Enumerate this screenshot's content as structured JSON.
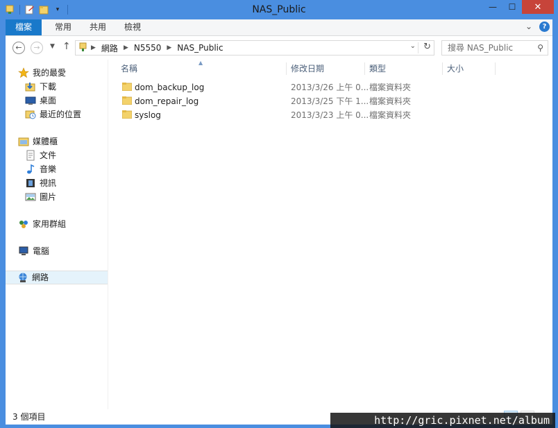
{
  "window": {
    "title": "NAS_Public",
    "buttons": {
      "minimize": "—",
      "maximize": "☐",
      "close": "✕"
    }
  },
  "ribbon": {
    "tabs": [
      "檔案",
      "常用",
      "共用",
      "檢視"
    ]
  },
  "address": {
    "crumbs": [
      "網路",
      "N5550",
      "NAS_Public"
    ],
    "search_placeholder": "搜尋 NAS_Public"
  },
  "nav": {
    "favorites": {
      "label": "我的最愛",
      "items": [
        "下載",
        "桌面",
        "最近的位置"
      ]
    },
    "libraries": {
      "label": "媒體櫃",
      "items": [
        "文件",
        "音樂",
        "視訊",
        "圖片"
      ]
    },
    "homegroup": "家用群組",
    "computer": "電腦",
    "network": "網路"
  },
  "columns": {
    "name": "名稱",
    "date": "修改日期",
    "type": "類型",
    "size": "大小"
  },
  "files": [
    {
      "name": "dom_backup_log",
      "date": "2013/3/26 上午 0...",
      "type": "檔案資料夾"
    },
    {
      "name": "dom_repair_log",
      "date": "2013/3/25 下午 1...",
      "type": "檔案資料夾"
    },
    {
      "name": "syslog",
      "date": "2013/3/23 上午 0...",
      "type": "檔案資料夾"
    }
  ],
  "status": {
    "item_count": "3 個項目"
  },
  "watermark": "http://gric.pixnet.net/album",
  "colors": {
    "titlebar": "#4a8ee0",
    "file_tab": "#1979ca",
    "close_button": "#c7443a"
  }
}
